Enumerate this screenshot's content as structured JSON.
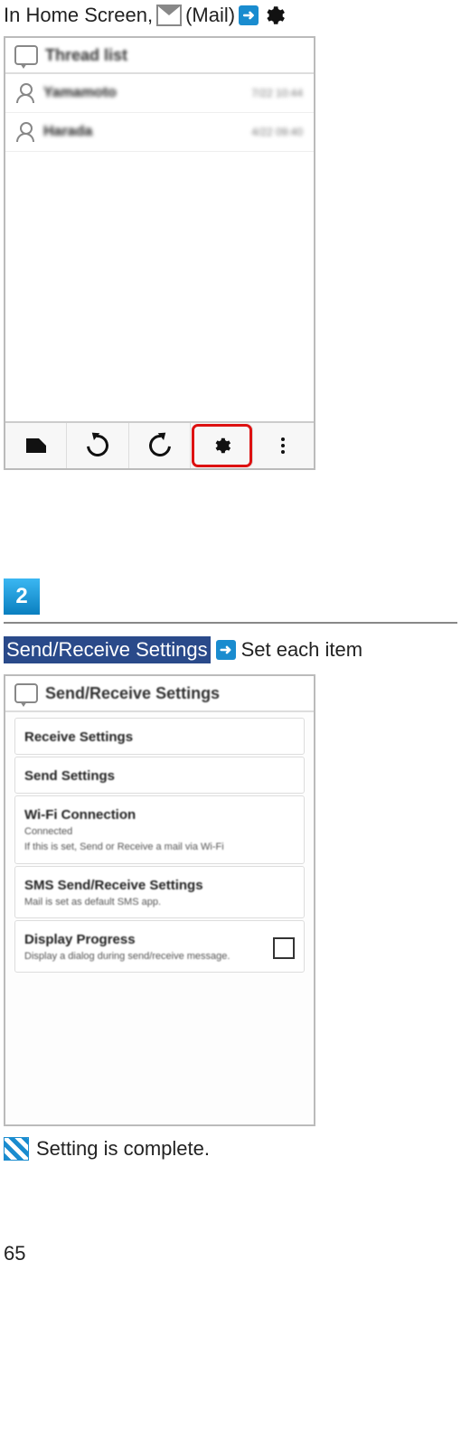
{
  "step1": {
    "prefix": "In Home Screen, ",
    "app_label": " (Mail)"
  },
  "screenshot1": {
    "header_title": "Thread list",
    "rows": [
      {
        "name": "Yamamoto",
        "meta": "7/22 10:44"
      },
      {
        "name": "Harada",
        "meta": "4/22 09:40"
      }
    ]
  },
  "stepnum": "2",
  "step2": {
    "highlight": "Send/Receive Settings",
    "tail": " Set each item"
  },
  "screenshot2": {
    "header_title": "Send/Receive Settings",
    "items": [
      {
        "title": "Receive Settings"
      },
      {
        "title": "Send Settings"
      },
      {
        "title": "Wi-Fi Connection",
        "sub1": "Connected",
        "sub2": "If this is set, Send or Receive a mail via Wi-Fi"
      },
      {
        "title": "SMS Send/Receive Settings",
        "sub1": "Mail is set as default SMS app."
      },
      {
        "title": "Display Progress",
        "sub1": "Display a dialog during send/receive message.",
        "checkbox": true
      }
    ]
  },
  "complete_text": " Setting is complete.",
  "page_number": "65"
}
